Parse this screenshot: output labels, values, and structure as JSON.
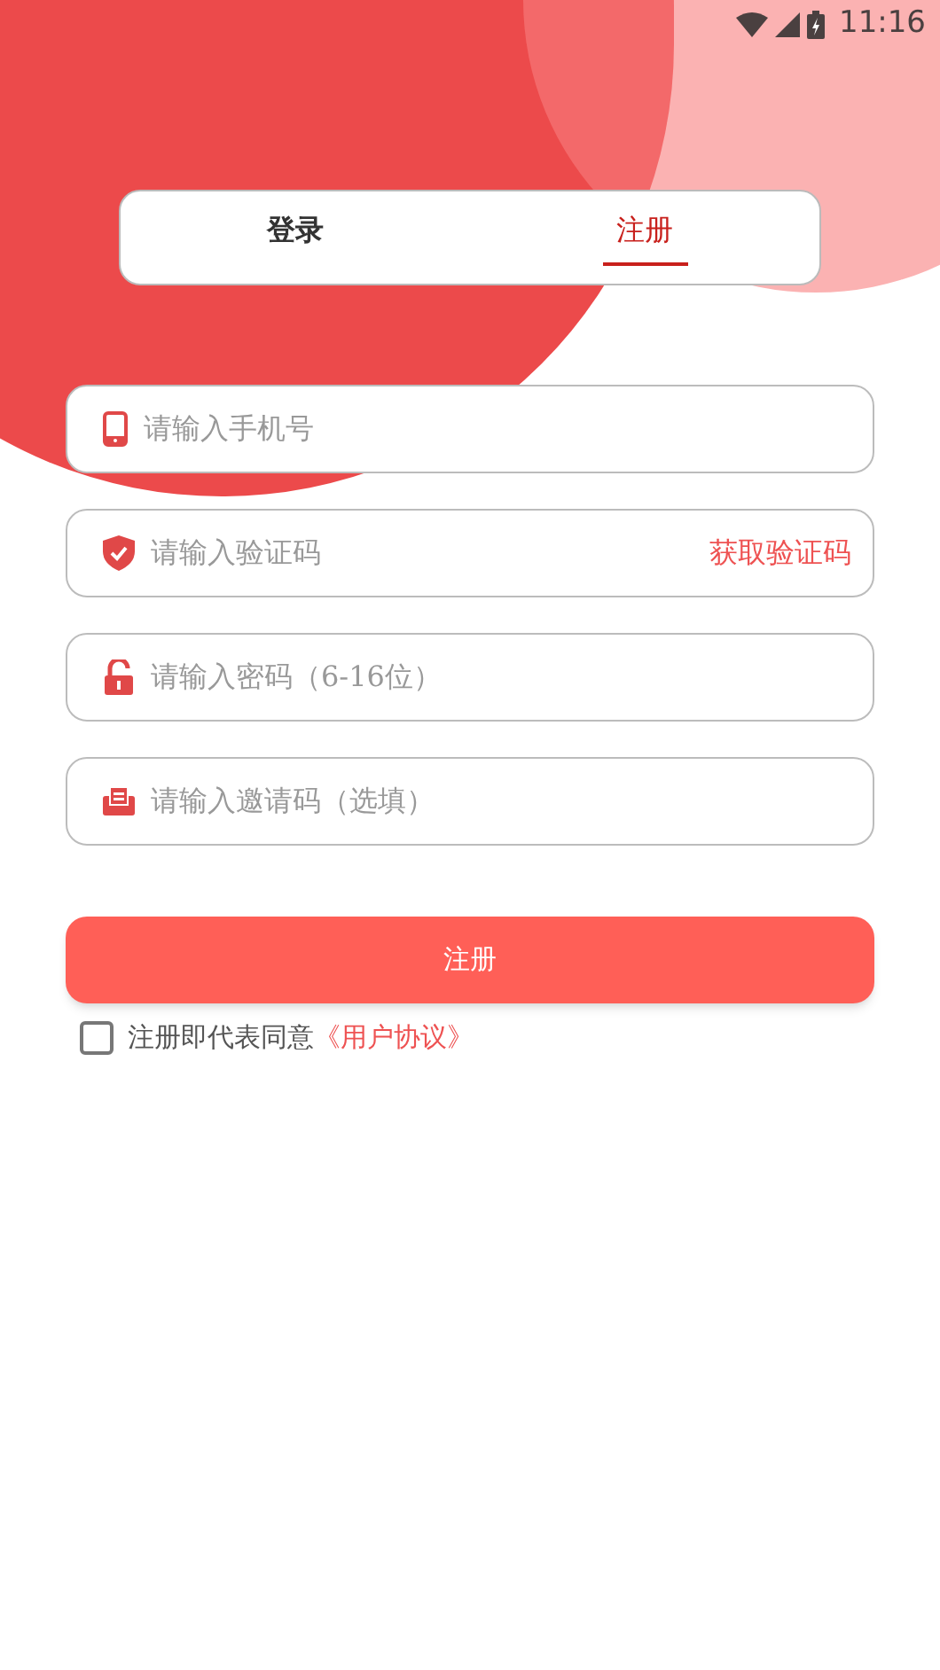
{
  "status_bar": {
    "time": "11:16"
  },
  "tabs": [
    {
      "label": "登录",
      "selected": false
    },
    {
      "label": "注册",
      "selected": true
    }
  ],
  "fields": [
    {
      "kind": "phone",
      "placeholder": "请输入手机号"
    },
    {
      "kind": "code",
      "placeholder": "请输入验证码",
      "action": "获取验证码"
    },
    {
      "kind": "password",
      "placeholder": "请输入密码（6-16位）"
    },
    {
      "kind": "invite",
      "placeholder": "请输入邀请码（选填）"
    }
  ],
  "submit_button": "注册",
  "agreement": {
    "checked": false,
    "text": "注册即代表同意",
    "link": "《用户协议》"
  }
}
